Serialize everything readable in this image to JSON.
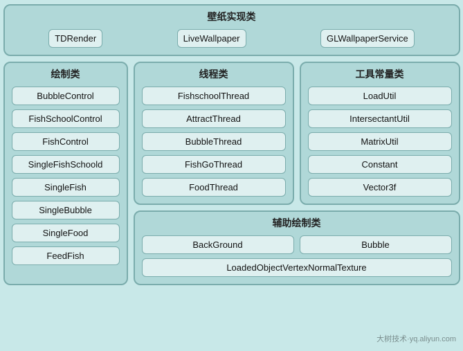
{
  "wallpaper": {
    "title": "壁纸实现类",
    "items": [
      "TDRender",
      "LiveWallpaper",
      "GLWallpaperService"
    ]
  },
  "drawing": {
    "title": "绘制类",
    "items": [
      "BubbleControl",
      "FishSchoolControl",
      "FishControl",
      "SingleFishSchoold",
      "SingleFish",
      "SingleBubble",
      "SingleFood",
      "FeedFish"
    ]
  },
  "thread": {
    "title": "线程类",
    "items": [
      "FishschoolThread",
      "AttractThread",
      "BubbleThread",
      "FishGoThread",
      "FoodThread"
    ]
  },
  "tools": {
    "title": "工具常量类",
    "items": [
      "LoadUtil",
      "IntersectantUtil",
      "MatrixUtil",
      "Constant",
      "Vector3f"
    ]
  },
  "aux": {
    "title": "辅助绘制类",
    "row1": [
      "BackGround",
      "Bubble"
    ],
    "row2": [
      "LoadedObjectVertexNormalTexture"
    ]
  },
  "watermark": "大树技术·yq.aliyun.com"
}
